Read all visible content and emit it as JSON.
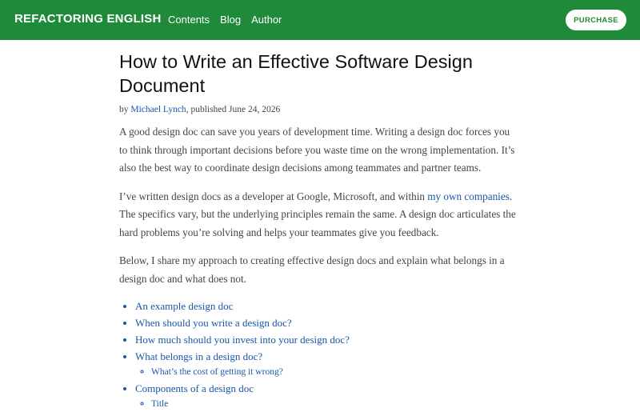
{
  "nav": {
    "brand": "REFACTORING ENGLISH",
    "links": [
      "Contents",
      "Blog",
      "Author"
    ],
    "purchase_label": "PURCHASE",
    "color_bg": "#1e8a3a"
  },
  "article": {
    "title": "How to Write an Effective Software Design Document",
    "byline_prefix": "by ",
    "author": "Michael Lynch",
    "byline_suffix": ", published June 24, 2026",
    "para1": "A good design doc can save you years of development time. Writing a design doc forces you to think through important decisions before you waste time on the wrong implementation. It’s also the best way to coordinate design decisions among teammates and partner teams.",
    "para2_before": "I’ve written design docs as a developer at Google, Microsoft, and within ",
    "para2_link": "my own companies",
    "para2_after": ". The specifics vary, but the underlying principles remain the same. A design doc articulates the hard problems you’re solving and helps your teammates give you feedback.",
    "para3": "Below, I share my approach to creating effective design docs and explain what belongs in a design doc and what does not.",
    "toc": [
      "An example design doc",
      "When should you write a design doc?",
      "How much should you invest into your design doc?",
      "What belongs in a design doc?",
      "What’s the cost of getting it wrong?",
      "Components of a design doc",
      "Title"
    ],
    "link_color": "#1a56a8"
  }
}
